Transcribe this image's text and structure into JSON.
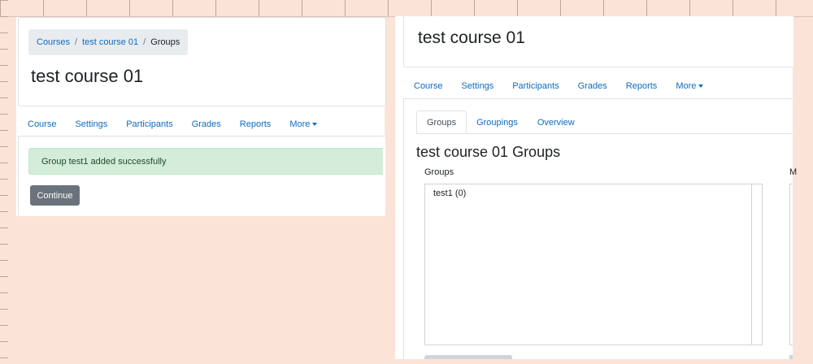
{
  "left_panel": {
    "breadcrumb": {
      "items": [
        {
          "label": "Courses"
        },
        {
          "label": "test course 01"
        }
      ],
      "separator": "/",
      "current": "Groups"
    },
    "title": "test course 01",
    "nav": [
      "Course",
      "Settings",
      "Participants",
      "Grades",
      "Reports"
    ],
    "nav_more": "More",
    "alert": "Group test1 added successfully",
    "continue_button": "Continue"
  },
  "right_panel": {
    "title": "test course 01",
    "nav": [
      "Course",
      "Settings",
      "Participants",
      "Grades",
      "Reports"
    ],
    "nav_more": "More",
    "tabs": [
      "Groups",
      "Groupings",
      "Overview"
    ],
    "heading": "test course 01 Groups",
    "groups_label": "Groups",
    "groups_list": [
      "test1 (0)"
    ],
    "members_label": "M"
  },
  "colors": {
    "background": "#fce3d7",
    "link": "#0f6cbf",
    "alert_bg": "#d4edda",
    "button": "#6a737b"
  }
}
